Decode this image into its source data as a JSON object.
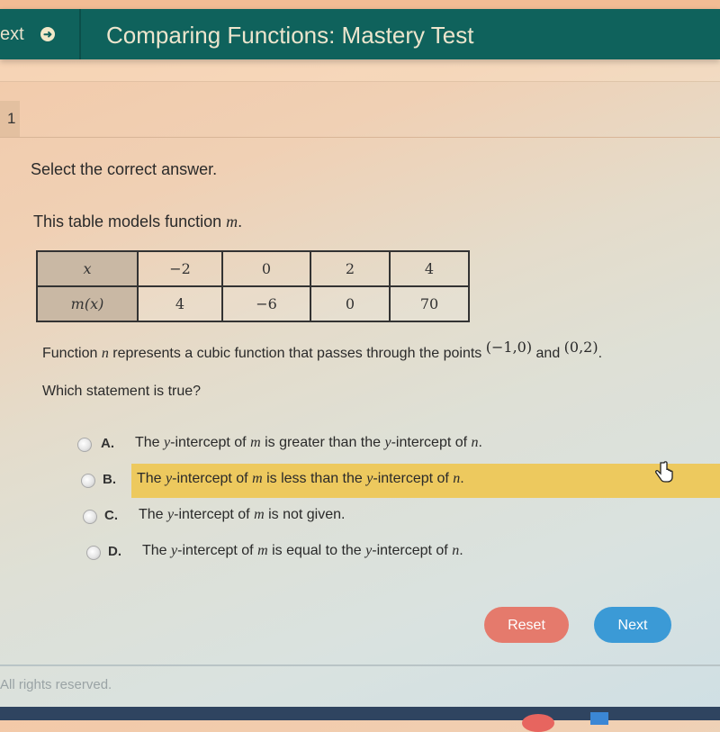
{
  "header": {
    "nav_label": "ext",
    "nav_icon": "arrow-right-circle-icon",
    "title": "Comparing Functions: Mastery Test"
  },
  "question_number": "1",
  "instruction": "Select the correct answer.",
  "intro_text": "This table models function ",
  "intro_var": "m",
  "intro_end": ".",
  "table": {
    "row_headers": [
      "x",
      "m(x)"
    ],
    "x_values": [
      "−2",
      "0",
      "2",
      "4"
    ],
    "m_values": [
      "4",
      "−6",
      "0",
      "70"
    ]
  },
  "function_description": {
    "pre": "Function ",
    "var": "n",
    "mid": " represents a cubic function that passes through the points ",
    "point1": "(−1,0)",
    "and": " and ",
    "point2": "(0,2)",
    "end": "."
  },
  "question": "Which statement is true?",
  "options": [
    {
      "letter": "A.",
      "t1": "The ",
      "v1": "y",
      "t2": "-intercept of ",
      "v2": "m",
      "t3": " is greater than the ",
      "v3": "y",
      "t4": "-intercept of ",
      "v4": "n",
      "t5": ".",
      "highlighted": false
    },
    {
      "letter": "B.",
      "t1": "The ",
      "v1": "y",
      "t2": "-intercept of ",
      "v2": "m",
      "t3": " is less than the ",
      "v3": "y",
      "t4": "-intercept of ",
      "v4": "n",
      "t5": ".",
      "highlighted": true
    },
    {
      "letter": "C.",
      "t1": "The ",
      "v1": "y",
      "t2": "-intercept of ",
      "v2": "m",
      "t3": " is not given.",
      "v3": "",
      "t4": "",
      "v4": "",
      "t5": "",
      "highlighted": false
    },
    {
      "letter": "D.",
      "t1": "The ",
      "v1": "y",
      "t2": "-intercept of ",
      "v2": "m",
      "t3": " is equal to the ",
      "v3": "y",
      "t4": "-intercept of ",
      "v4": "n",
      "t5": ".",
      "highlighted": false
    }
  ],
  "buttons": {
    "reset": "Reset",
    "next": "Next"
  },
  "colors": {
    "header_bg": "#0f625c",
    "highlight": "#edc95e",
    "reset_bg": "#e57a6c",
    "next_bg": "#3b9ad6"
  },
  "footer": "All rights reserved."
}
